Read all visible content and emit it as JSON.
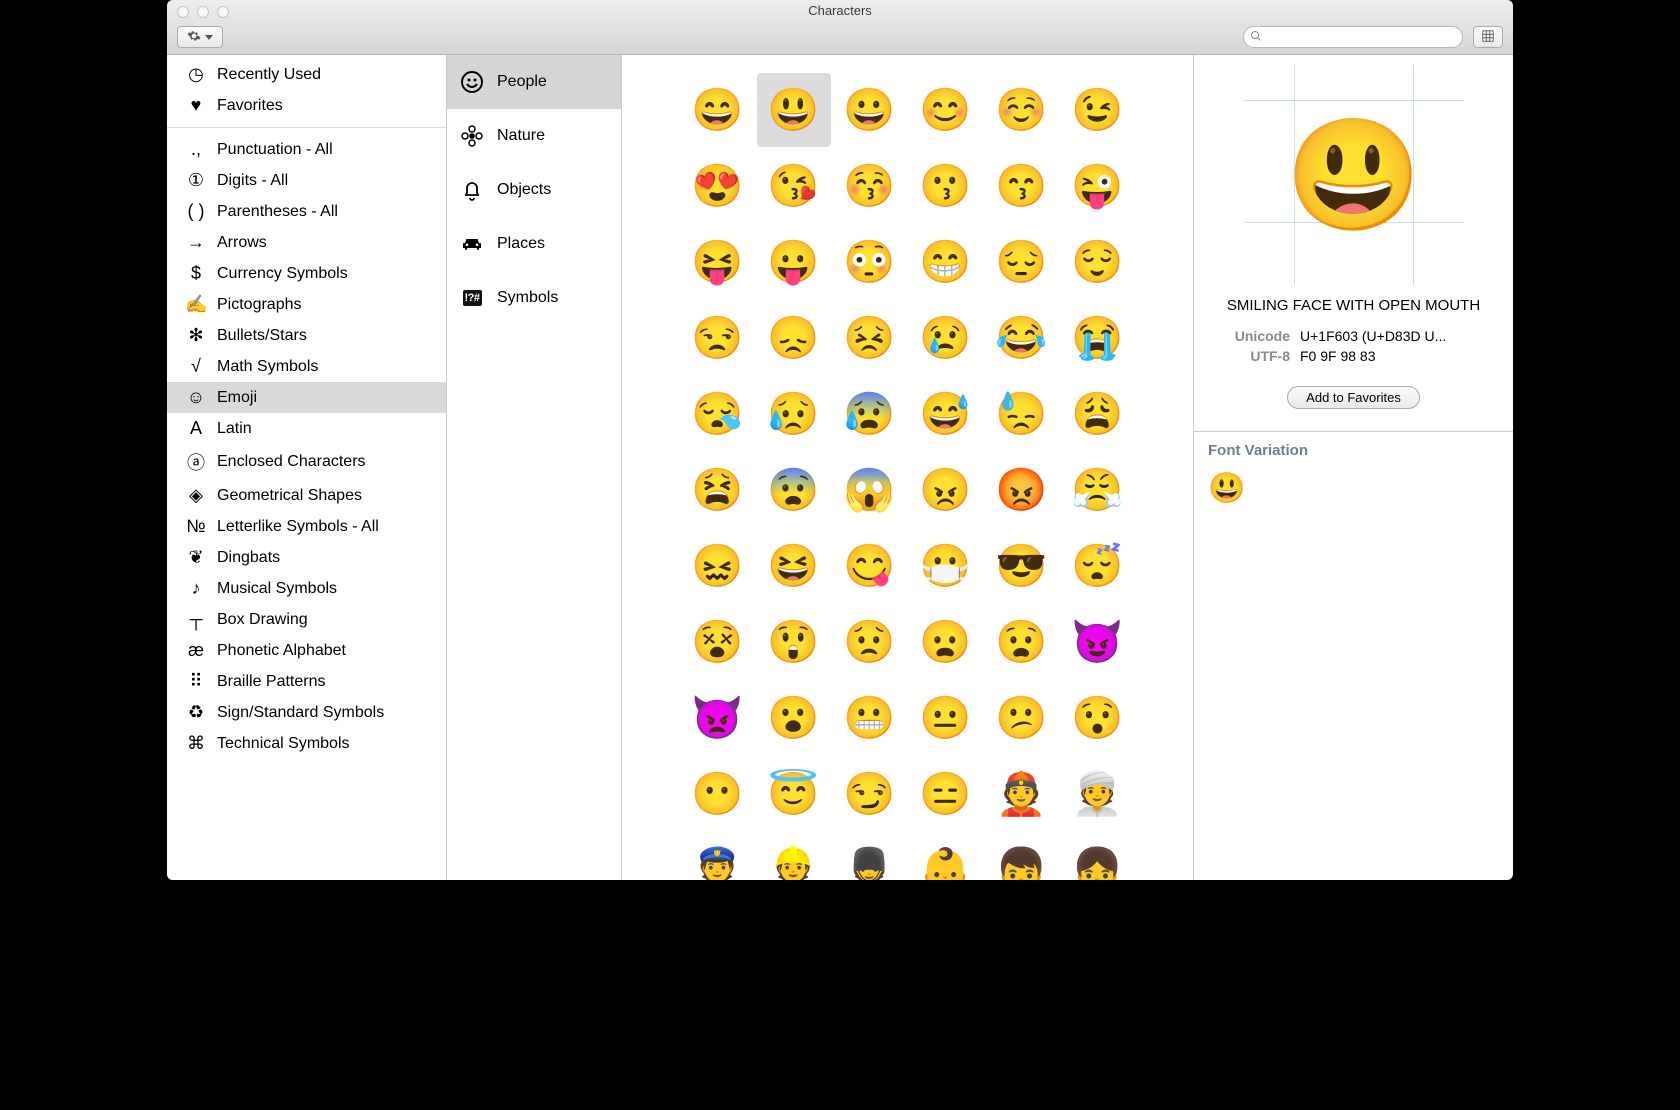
{
  "window": {
    "title": "Characters"
  },
  "search": {
    "placeholder": ""
  },
  "sidebar1": {
    "top": [
      {
        "name": "recently-used",
        "icon": "clock",
        "iconGlyph": "◷",
        "label": "Recently Used"
      },
      {
        "name": "favorites",
        "icon": "heart",
        "iconGlyph": "♥",
        "label": "Favorites"
      }
    ],
    "categories": [
      {
        "name": "punctuation-all",
        "iconGlyph": ".,",
        "label": "Punctuation - All"
      },
      {
        "name": "digits-all",
        "iconGlyph": "①",
        "label": "Digits - All"
      },
      {
        "name": "parentheses-all",
        "iconGlyph": "( )",
        "label": "Parentheses - All"
      },
      {
        "name": "arrows",
        "iconGlyph": "→",
        "label": "Arrows"
      },
      {
        "name": "currency-symbols",
        "iconGlyph": "$",
        "label": "Currency Symbols"
      },
      {
        "name": "pictographs",
        "iconGlyph": "✍",
        "label": "Pictographs"
      },
      {
        "name": "bullets-stars",
        "iconGlyph": "✻",
        "label": "Bullets/Stars"
      },
      {
        "name": "math-symbols",
        "iconGlyph": "√",
        "label": "Math Symbols"
      },
      {
        "name": "emoji",
        "iconGlyph": "☺",
        "label": "Emoji",
        "selected": true
      },
      {
        "name": "latin",
        "iconGlyph": "A",
        "label": "Latin"
      },
      {
        "name": "enclosed-characters",
        "iconGlyph": "ⓐ",
        "label": "Enclosed Characters"
      },
      {
        "name": "geometrical-shapes",
        "iconGlyph": "◈",
        "label": "Geometrical Shapes"
      },
      {
        "name": "letterlike-symbols-all",
        "iconGlyph": "№",
        "label": "Letterlike Symbols - All"
      },
      {
        "name": "dingbats",
        "iconGlyph": "❦",
        "label": "Dingbats"
      },
      {
        "name": "musical-symbols",
        "iconGlyph": "♪",
        "label": "Musical Symbols"
      },
      {
        "name": "box-drawing",
        "iconGlyph": "┬",
        "label": "Box Drawing"
      },
      {
        "name": "phonetic-alphabet",
        "iconGlyph": "æ",
        "label": "Phonetic Alphabet"
      },
      {
        "name": "braille-patterns",
        "iconGlyph": "⠿",
        "label": "Braille Patterns"
      },
      {
        "name": "sign-standard-symbols",
        "iconGlyph": "♻",
        "label": "Sign/Standard Symbols"
      },
      {
        "name": "technical-symbols",
        "iconGlyph": "⌘",
        "label": "Technical Symbols"
      }
    ]
  },
  "sidebar2": {
    "items": [
      {
        "name": "people",
        "iconKind": "smiley",
        "label": "People",
        "selected": true
      },
      {
        "name": "nature",
        "iconKind": "flower",
        "label": "Nature"
      },
      {
        "name": "objects",
        "iconKind": "bell",
        "label": "Objects"
      },
      {
        "name": "places",
        "iconKind": "car",
        "label": "Places"
      },
      {
        "name": "symbols",
        "iconKind": "symbox",
        "label": "Symbols"
      }
    ]
  },
  "grid": {
    "selectedIndex": 1,
    "chars": [
      "😄",
      "😃",
      "😀",
      "😊",
      "☺️",
      "😉",
      "😍",
      "😘",
      "😚",
      "😗",
      "😙",
      "😜",
      "😝",
      "😛",
      "😳",
      "😁",
      "😔",
      "😌",
      "😒",
      "😞",
      "😣",
      "😢",
      "😂",
      "😭",
      "😪",
      "😥",
      "😰",
      "😅",
      "😓",
      "😩",
      "😫",
      "😨",
      "😱",
      "😠",
      "😡",
      "😤",
      "😖",
      "😆",
      "😋",
      "😷",
      "😎",
      "😴",
      "😵",
      "😲",
      "😟",
      "😦",
      "😧",
      "😈",
      "👿",
      "😮",
      "😬",
      "😐",
      "😕",
      "😯",
      "😶",
      "😇",
      "😏",
      "😑",
      "👲",
      "👳",
      "👮",
      "👷",
      "💂",
      "👶",
      "👦",
      "👧"
    ]
  },
  "detail": {
    "glyph": "😃",
    "name": "SMILING FACE WITH OPEN MOUTH",
    "unicode_label": "Unicode",
    "unicode_value": "U+1F603 (U+D83D U...",
    "utf8_label": "UTF-8",
    "utf8_value": "F0 9F 98 83",
    "add_favorites": "Add to Favorites",
    "font_variation_header": "Font Variation",
    "variation_glyph": "😃"
  }
}
